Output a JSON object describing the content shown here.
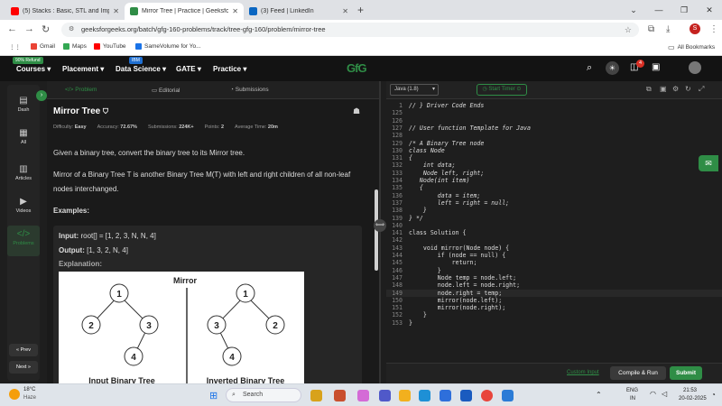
{
  "browser": {
    "tabs": [
      {
        "title": "(5) Stacks : Basic, STL and Impl",
        "icon_color": "#ff0000",
        "active": false
      },
      {
        "title": "Mirror Tree | Practice | Geeksfo",
        "icon_color": "#2f8d46",
        "active": true
      },
      {
        "title": "(3) Feed | LinkedIn",
        "icon_color": "#0a66c2",
        "active": false
      }
    ],
    "new_tab": "+",
    "url": "geeksforgeeks.org/batch/gfg-160-problems/track/tree-gfg-160/problem/mirror-tree",
    "bookmarks": [
      {
        "label": "Gmail",
        "color": "#ea4335"
      },
      {
        "label": "Maps",
        "color": "#34a853"
      },
      {
        "label": "YouTube",
        "color": "#ff0000"
      },
      {
        "label": "SameVolume for Yo...",
        "color": "#1a73e8"
      }
    ],
    "all_bookmarks": "All Bookmarks",
    "profile_initial": "S"
  },
  "site_header": {
    "nav": [
      {
        "label": "Courses ▾",
        "badge": "90% Refund"
      },
      {
        "label": "Placement ▾",
        "badge": ""
      },
      {
        "label": "Data Science ▾",
        "badge": "IBM"
      },
      {
        "label": "GATE ▾",
        "badge": ""
      },
      {
        "label": "Practice ▾",
        "badge": ""
      }
    ],
    "logo": "GfG",
    "notification_count": "4"
  },
  "rail": {
    "items": [
      "Dash",
      "All",
      "Articles",
      "Videos",
      "Problems"
    ],
    "prev": "« Prev",
    "next": "Next »"
  },
  "problem": {
    "tabs": [
      "Problem",
      "Editorial",
      "Submissions"
    ],
    "title": "Mirror Tree",
    "stats": {
      "difficulty_label": "Difficulty:",
      "difficulty": "Easy",
      "accuracy_label": "Accuracy:",
      "accuracy": "72.67%",
      "submissions_label": "Submissions:",
      "submissions": "224K+",
      "points_label": "Points:",
      "points": "2",
      "time_label": "Average Time:",
      "time": "20m"
    },
    "p1": "Given a binary tree, convert the binary tree to its Mirror tree.",
    "p2": "Mirror of a Binary Tree T is another Binary Tree M(T) with left and right children of all non-leaf nodes interchanged.",
    "examples_heading": "Examples:",
    "input_label": "Input:",
    "input_value": "root[] = [1, 2, 3, N, N, 4]",
    "output_label": "Output:",
    "output_value": "[1, 3, 2, N, 4]",
    "explanation_label": "Explanation:",
    "figure": {
      "title": "Mirror",
      "left_caption": "Input Binary Tree",
      "right_caption": "Inverted Binary Tree",
      "left_nodes": [
        "1",
        "2",
        "3",
        "4"
      ],
      "right_nodes": [
        "1",
        "3",
        "2",
        "4"
      ]
    }
  },
  "editor": {
    "language": "Java (1.8)",
    "timer": "Start Timer",
    "lines": [
      {
        "n": "1",
        "text": "// } Driver Code Ends",
        "cls": "cm"
      },
      {
        "n": "125",
        "text": "",
        "cls": ""
      },
      {
        "n": "126",
        "text": "",
        "cls": ""
      },
      {
        "n": "127",
        "text": "// User function Template for Java",
        "cls": "cm"
      },
      {
        "n": "128",
        "text": "",
        "cls": ""
      },
      {
        "n": "129",
        "text": "/* A Binary Tree node",
        "cls": "cm"
      },
      {
        "n": "130",
        "text": "class Node",
        "cls": "cm"
      },
      {
        "n": "131",
        "text": "{",
        "cls": "cm"
      },
      {
        "n": "132",
        "text": "    int data;",
        "cls": "cm"
      },
      {
        "n": "133",
        "text": "    Node left, right;",
        "cls": "cm"
      },
      {
        "n": "134",
        "text": "   Node(int item)",
        "cls": "cm"
      },
      {
        "n": "135",
        "text": "   {",
        "cls": "cm"
      },
      {
        "n": "136",
        "text": "        data = item;",
        "cls": "cm"
      },
      {
        "n": "137",
        "text": "        left = right = null;",
        "cls": "cm"
      },
      {
        "n": "138",
        "text": "    }",
        "cls": "cm"
      },
      {
        "n": "139",
        "text": "} */",
        "cls": "cm"
      },
      {
        "n": "140",
        "text": "",
        "cls": ""
      },
      {
        "n": "141",
        "text": "class Solution {",
        "cls": ""
      },
      {
        "n": "142",
        "text": "",
        "cls": ""
      },
      {
        "n": "143",
        "text": "    void mirror(Node node) {",
        "cls": ""
      },
      {
        "n": "144",
        "text": "        if (node == null) {",
        "cls": ""
      },
      {
        "n": "145",
        "text": "            return;",
        "cls": ""
      },
      {
        "n": "146",
        "text": "        }",
        "cls": ""
      },
      {
        "n": "147",
        "text": "        Node temp = node.left;",
        "cls": ""
      },
      {
        "n": "148",
        "text": "        node.left = node.right;",
        "cls": ""
      },
      {
        "n": "149",
        "text": "        node.right = temp;",
        "cls": "cur"
      },
      {
        "n": "150",
        "text": "        mirror(node.left);",
        "cls": ""
      },
      {
        "n": "151",
        "text": "        mirror(node.right);",
        "cls": ""
      },
      {
        "n": "152",
        "text": "    }",
        "cls": ""
      },
      {
        "n": "153",
        "text": "}",
        "cls": ""
      }
    ],
    "custom_input": "Custom Input",
    "compile_run": "Compile & Run",
    "submit": "Submit"
  },
  "taskbar": {
    "weather_temp": "18°C",
    "weather_desc": "Haze",
    "search_placeholder": "Search",
    "lang": "ENG",
    "region": "IN",
    "time": "21:53",
    "date": "20-02-2025"
  }
}
